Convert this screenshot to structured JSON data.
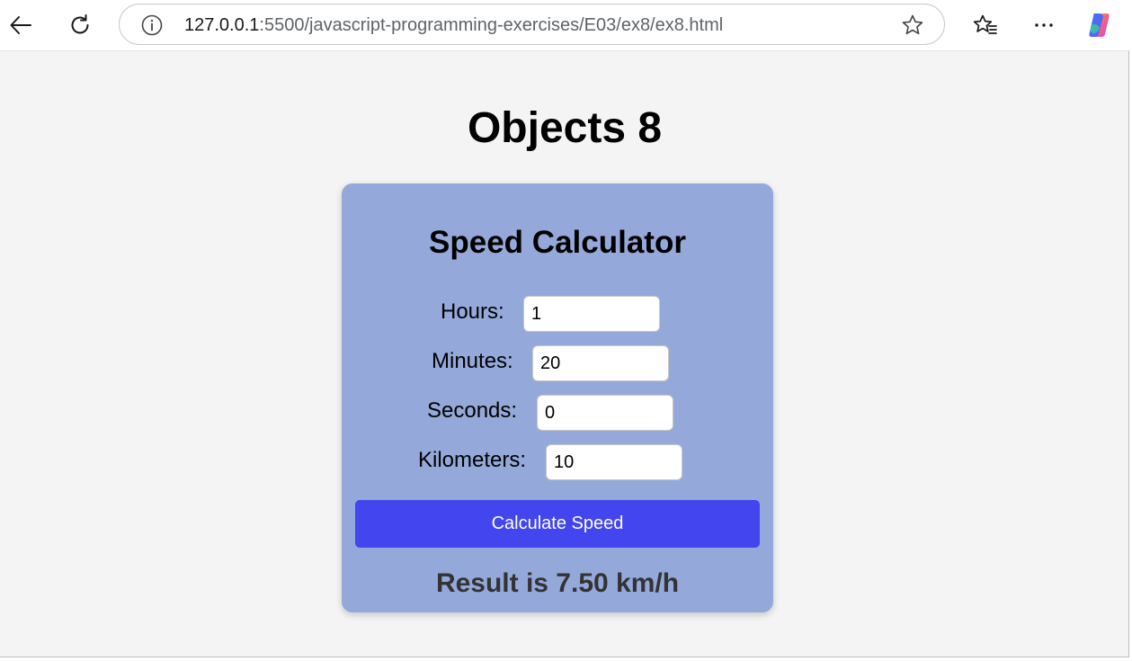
{
  "browser": {
    "url_host": "127.0.0.1",
    "url_rest": ":5500/javascript-programming-exercises/E03/ex8/ex8.html",
    "icons": {
      "back": "back-arrow-icon",
      "reload": "reload-icon",
      "info": "site-info-icon",
      "favorite": "star-icon",
      "favorites": "favorites-list-icon",
      "more": "more-dots-icon",
      "copilot": "copilot-icon"
    }
  },
  "page": {
    "title": "Objects 8",
    "card": {
      "title": "Speed Calculator",
      "fields": {
        "hours": {
          "label": "Hours:",
          "value": "1"
        },
        "minutes": {
          "label": "Minutes:",
          "value": "20"
        },
        "seconds": {
          "label": "Seconds:",
          "value": "0"
        },
        "kilometers": {
          "label": "Kilometers:",
          "value": "10"
        }
      },
      "button_label": "Calculate Speed",
      "result": "Result is 7.50 km/h"
    }
  },
  "colors": {
    "page_bg": "#f4f4f4",
    "card_bg": "#94a9da",
    "button_bg": "#4346ee",
    "button_text": "#ffffff",
    "result_text": "#333333"
  }
}
